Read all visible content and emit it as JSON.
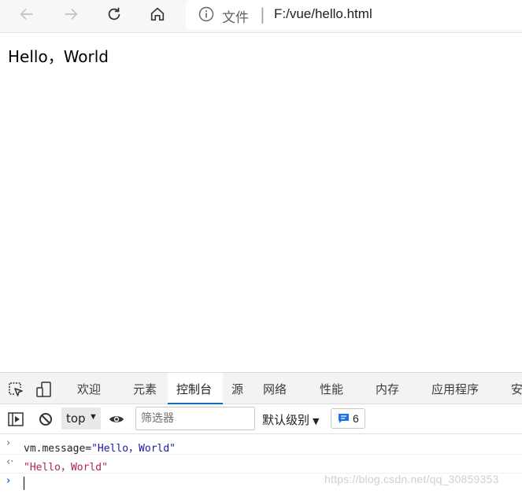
{
  "browser": {
    "address_scheme": "文件",
    "address_separator": "|",
    "address_url": "F:/vue/hello.html"
  },
  "page": {
    "text": "Hello，World"
  },
  "devtools": {
    "tabs": [
      "欢迎",
      "元素",
      "控制台",
      "源",
      "网络",
      "性能",
      "内存",
      "应用程序",
      "安"
    ],
    "active_tab": "控制台",
    "context": "top",
    "filter_placeholder": "筛选器",
    "level_label": "默认级别",
    "issues_count": "6",
    "console": {
      "command_var": "vm.message=",
      "command_value": "\"Hello，World\"",
      "result": "\"Hello，World\""
    }
  },
  "watermark": "https://blog.csdn.net/qq_30859353"
}
